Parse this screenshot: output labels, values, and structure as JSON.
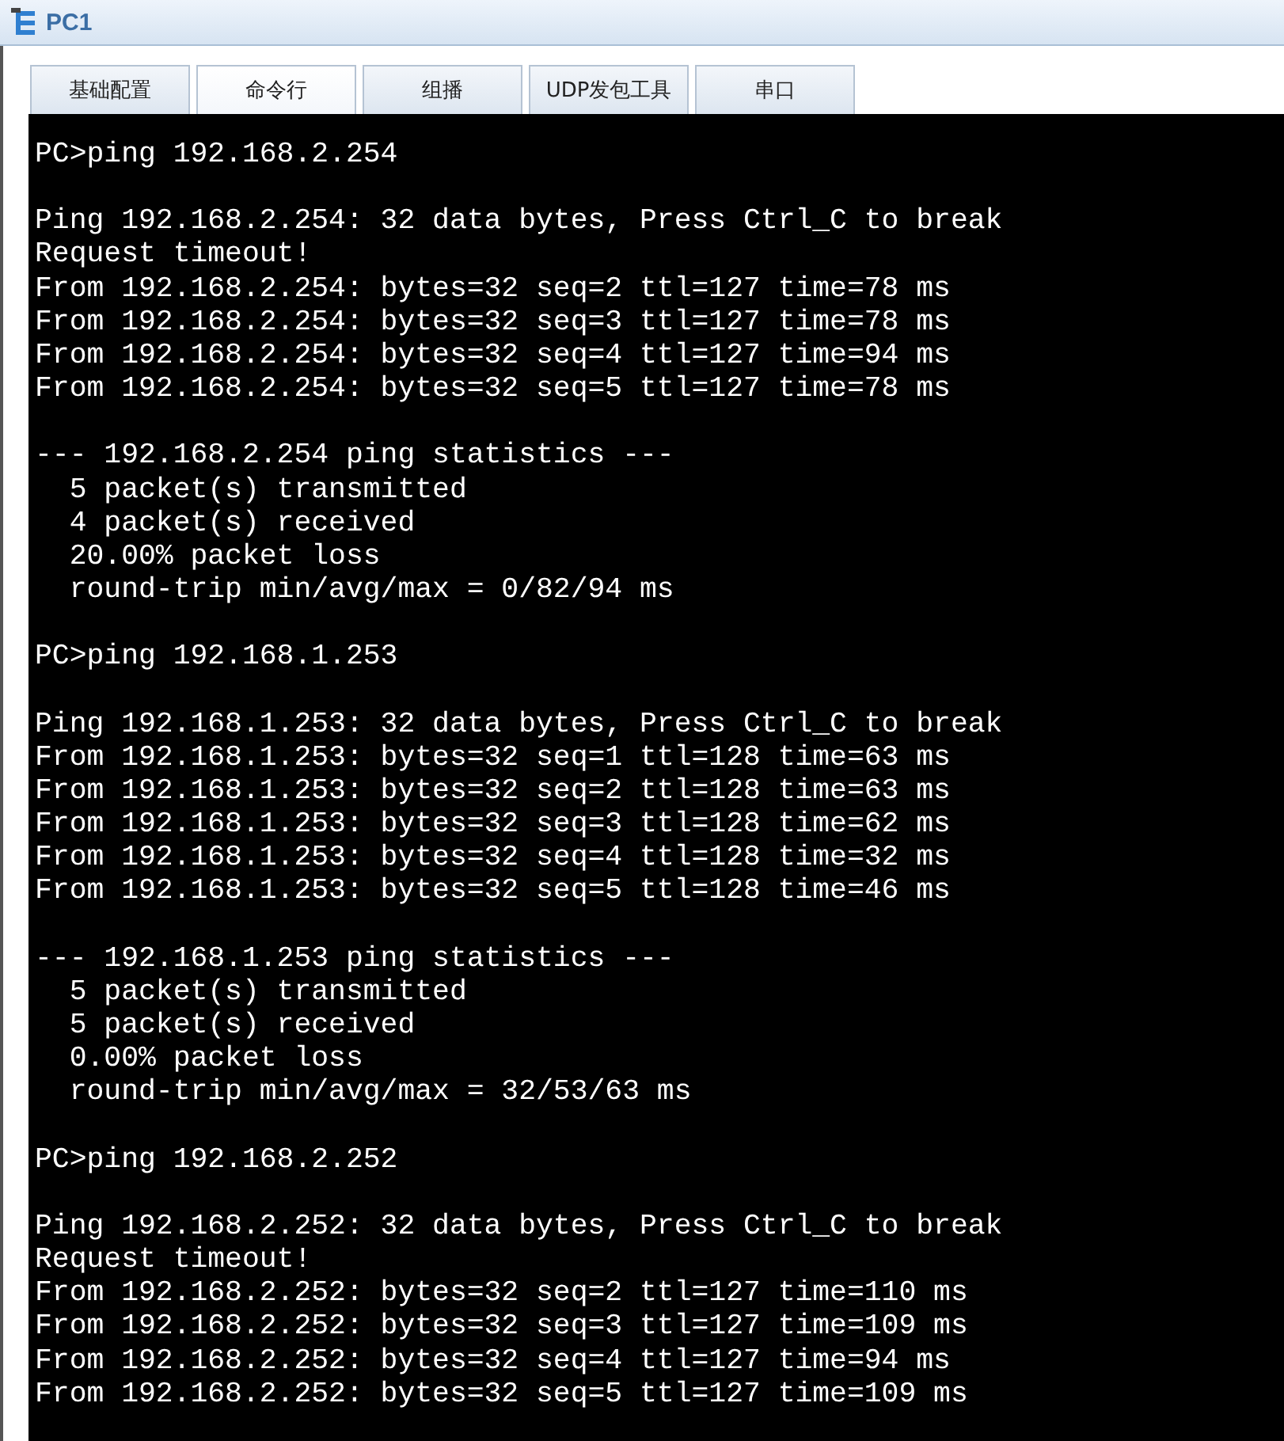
{
  "window": {
    "title": "PC1"
  },
  "tabs": [
    {
      "label": "基础配置",
      "selected": false
    },
    {
      "label": "命令行",
      "selected": true
    },
    {
      "label": "组播",
      "selected": false
    },
    {
      "label": "UDP发包工具",
      "selected": false
    },
    {
      "label": "串口",
      "selected": false
    }
  ],
  "terminal": {
    "blocks": [
      [
        "PC>ping 192.168.2.254"
      ],
      [
        "Ping 192.168.2.254: 32 data bytes, Press Ctrl_C to break",
        "Request timeout!",
        "From 192.168.2.254: bytes=32 seq=2 ttl=127 time=78 ms",
        "From 192.168.2.254: bytes=32 seq=3 ttl=127 time=78 ms",
        "From 192.168.2.254: bytes=32 seq=4 ttl=127 time=94 ms",
        "From 192.168.2.254: bytes=32 seq=5 ttl=127 time=78 ms"
      ],
      [
        "--- 192.168.2.254 ping statistics ---",
        "  5 packet(s) transmitted",
        "  4 packet(s) received",
        "  20.00% packet loss",
        "  round-trip min/avg/max = 0/82/94 ms"
      ],
      [
        "PC>ping 192.168.1.253"
      ],
      [
        "Ping 192.168.1.253: 32 data bytes, Press Ctrl_C to break",
        "From 192.168.1.253: bytes=32 seq=1 ttl=128 time=63 ms",
        "From 192.168.1.253: bytes=32 seq=2 ttl=128 time=63 ms",
        "From 192.168.1.253: bytes=32 seq=3 ttl=128 time=62 ms",
        "From 192.168.1.253: bytes=32 seq=4 ttl=128 time=32 ms",
        "From 192.168.1.253: bytes=32 seq=5 ttl=128 time=46 ms"
      ],
      [
        "--- 192.168.1.253 ping statistics ---",
        "  5 packet(s) transmitted",
        "  5 packet(s) received",
        "  0.00% packet loss",
        "  round-trip min/avg/max = 32/53/63 ms"
      ],
      [
        "PC>ping 192.168.2.252"
      ],
      [
        "Ping 192.168.2.252: 32 data bytes, Press Ctrl_C to break",
        "Request timeout!",
        "From 192.168.2.252: bytes=32 seq=2 ttl=127 time=110 ms",
        "From 192.168.2.252: bytes=32 seq=3 ttl=127 time=109 ms",
        "From 192.168.2.252: bytes=32 seq=4 ttl=127 time=94 ms",
        "From 192.168.2.252: bytes=32 seq=5 ttl=127 time=109 ms"
      ]
    ]
  }
}
